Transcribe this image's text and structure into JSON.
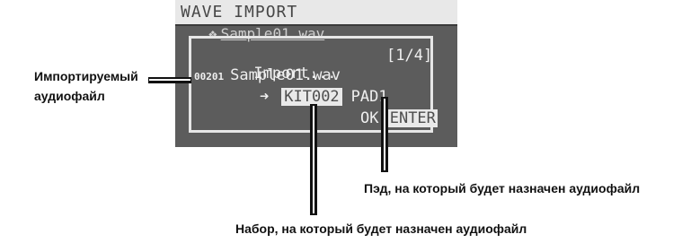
{
  "screen": {
    "title": "WAVE IMPORT",
    "behind_file": "Sample01.wav",
    "dialog": {
      "heading": "Import...",
      "page": "[1/4]",
      "file_number": "00201",
      "file_name": "Sample01.wav",
      "arrow": "➜",
      "kit": "KIT002",
      "pad": "PAD1",
      "ok_label": "OK:",
      "enter_label": "ENTER"
    }
  },
  "callouts": {
    "file_line1": "Импортируемый",
    "file_line2": "аудиофайл",
    "pad": "Пэд, на который будет назначен аудиофайл",
    "kit": "Набор, на который будет назначен аудиофайл"
  }
}
